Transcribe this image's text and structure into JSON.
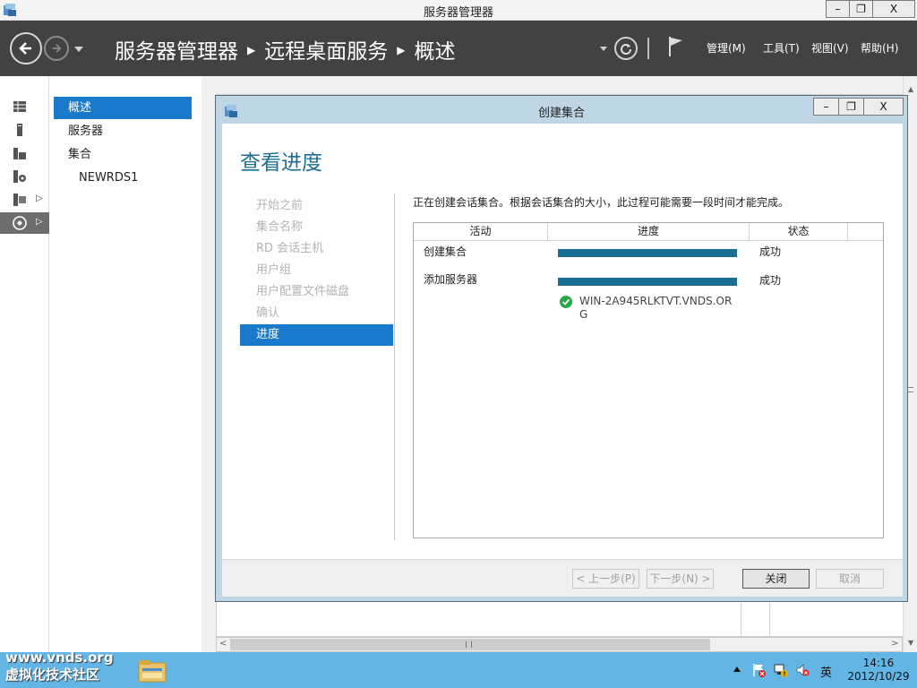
{
  "window": {
    "title": "服务器管理器",
    "minimize": "–",
    "restore": "❐",
    "close": "X"
  },
  "header": {
    "breadcrumb": [
      "服务器管理器",
      "远程桌面服务",
      "概述"
    ],
    "menus": [
      "管理(M)",
      "工具(T)",
      "视图(V)",
      "帮助(H)"
    ]
  },
  "leftbar": {
    "icons": [
      "dashboard-icon",
      "local-server-icon",
      "all-servers-icon",
      "file-storage-icon",
      "iis-icon",
      "rds-icon"
    ],
    "expand_arrow": "▷"
  },
  "nav": {
    "items": [
      {
        "label": "概述",
        "selected": true
      },
      {
        "label": "服务器",
        "selected": false
      },
      {
        "label": "集合",
        "selected": false
      },
      {
        "label": "NEWRDS1",
        "selected": false,
        "sub": true
      }
    ]
  },
  "dialog": {
    "title": "创建集合",
    "heading": "查看进度",
    "steps": [
      "开始之前",
      "集合名称",
      "RD 会话主机",
      "用户组",
      "用户配置文件磁盘",
      "确认",
      "进度"
    ],
    "current_step": "进度",
    "description": "正在创建会话集合。根据会话集合的大小，此过程可能需要一段时间才能完成。",
    "table": {
      "columns": [
        "活动",
        "进度",
        "状态"
      ],
      "rows": [
        {
          "activity": "创建集合",
          "progress": 1.0,
          "status": "成功"
        },
        {
          "activity": "添加服务器",
          "progress": 1.0,
          "status": "成功"
        }
      ],
      "sub_item": "WIN-2A945RLKTVT.VNDS.ORG"
    },
    "buttons": {
      "prev": "< 上一步(P)",
      "next": "下一步(N) >",
      "close": "关闭",
      "cancel": "取消"
    }
  },
  "taskbar": {
    "watermark_line1": "www.vnds.org",
    "watermark_line2": "虚拟化技术社区",
    "ime": "英",
    "time": "14:16",
    "date": "2012/10/29"
  },
  "colors": {
    "header_bg": "#424242",
    "accent": "#1979ca",
    "heading": "#1d6f95",
    "progress": "#1a6e90",
    "taskbar": "#63b5e6"
  }
}
